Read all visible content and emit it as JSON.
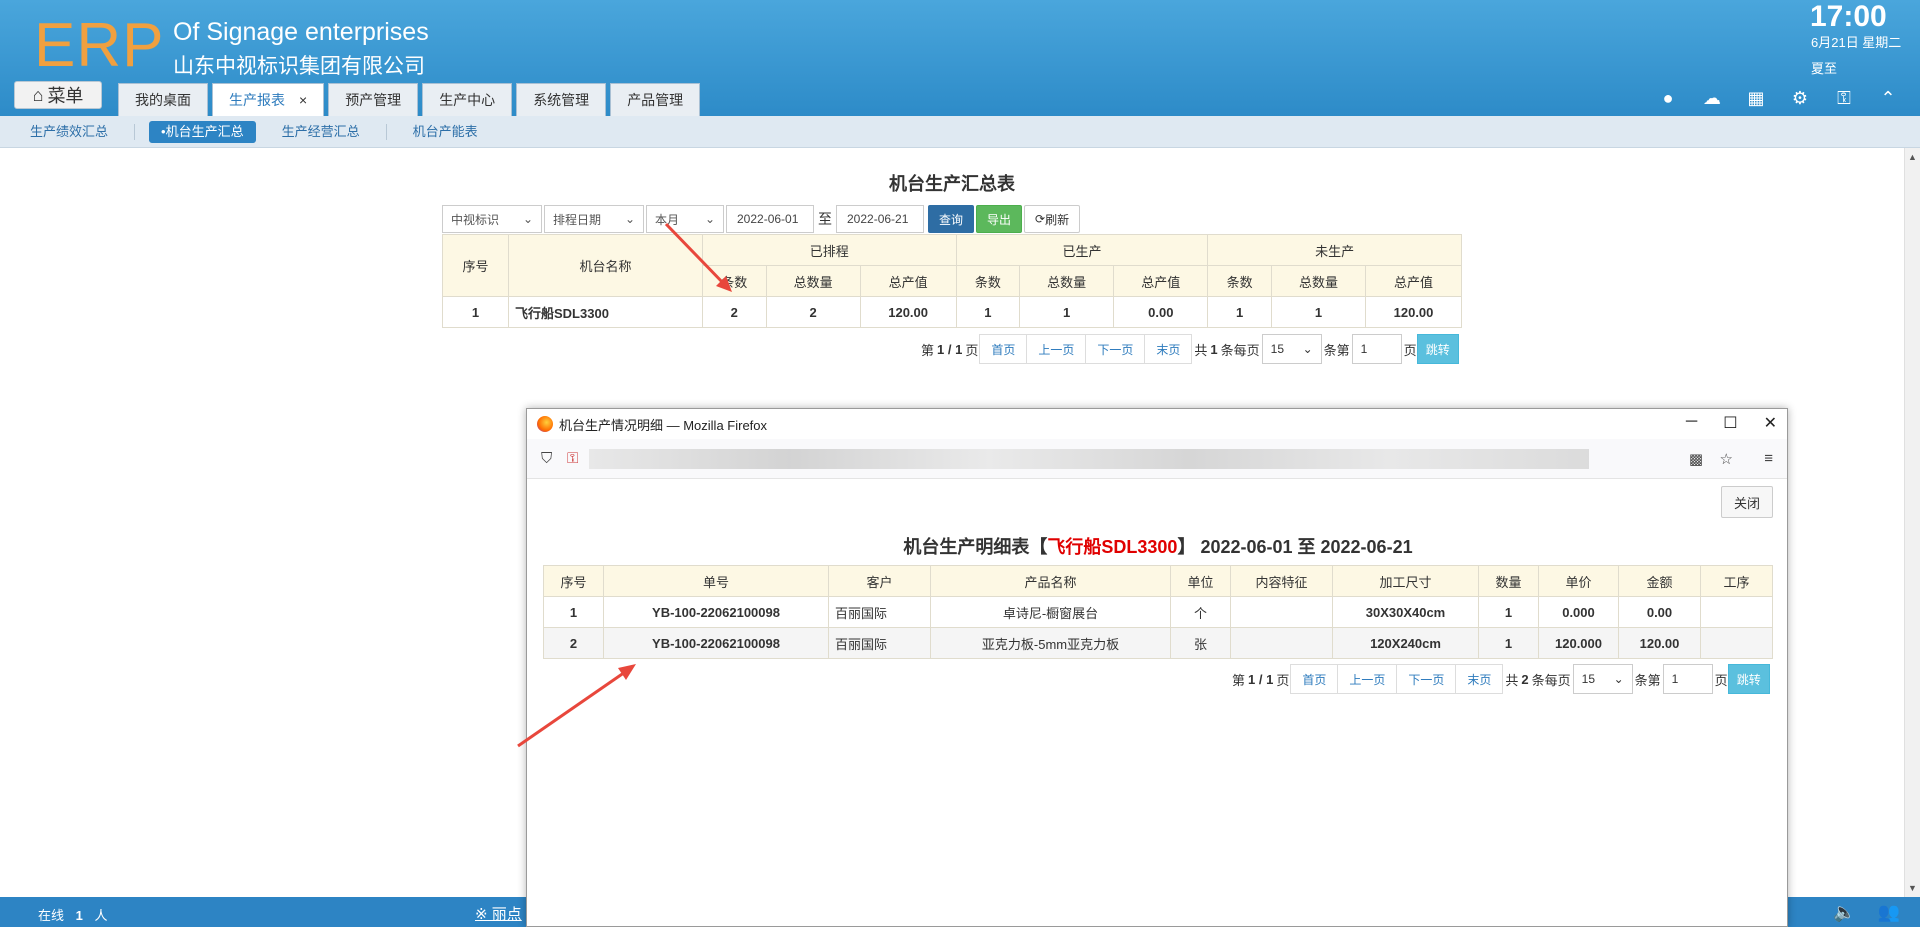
{
  "header": {
    "logo": "ERP",
    "company_en": "Of Signage enterprises",
    "company_cn": "山东中视标识集团有限公司",
    "time": "17:00",
    "date": "6月21日 星期二",
    "solar_term": "夏至",
    "menu_label": "菜单",
    "tabs": [
      {
        "label": "我的桌面"
      },
      {
        "label": "生产报表"
      },
      {
        "label": "预产管理"
      },
      {
        "label": "生产中心"
      },
      {
        "label": "系统管理"
      },
      {
        "label": "产品管理"
      }
    ],
    "tab_close": "×"
  },
  "subnav": {
    "items": [
      {
        "label": "生产绩效汇总"
      },
      {
        "label": "•机台生产汇总"
      },
      {
        "label": "生产经营汇总"
      },
      {
        "label": "机台产能表"
      }
    ]
  },
  "main": {
    "title": "机台生产汇总表",
    "filters": {
      "company": "中视标识",
      "date_type": "排程日期",
      "period": "本月",
      "date_from": "2022-06-01",
      "to_label": "至",
      "date_to": "2022-06-21",
      "query_btn": "查询",
      "export_btn": "导出",
      "refresh_btn": "刷新"
    },
    "table": {
      "h_seq": "序号",
      "h_machine": "机台名称",
      "h_scheduled": "已排程",
      "h_produced": "已生产",
      "h_unproduced": "未生产",
      "h_count": "条数",
      "h_qty": "总数量",
      "h_value": "总产值",
      "rows": [
        {
          "seq": "1",
          "machine": "飞行船SDL3300",
          "s_count": "2",
          "s_qty": "2",
          "s_value": "120.00",
          "p_count": "1",
          "p_qty": "1",
          "p_value": "0.00",
          "u_count": "1",
          "u_qty": "1",
          "u_value": "120.00"
        }
      ]
    },
    "pager": {
      "page_info_pre": "第",
      "page_info": "1 / 1",
      "page_info_post": "页",
      "first": "首页",
      "prev": "上一页",
      "next": "下一页",
      "last": "末页",
      "total_pre": "共",
      "total": "1",
      "total_post": "条每页",
      "per_page": "15",
      "jump_pre": "条第",
      "jump_page": "1",
      "jump_post": "页",
      "go": "跳转"
    }
  },
  "statusbar": {
    "online_pre": "在线",
    "online_count": "1",
    "online_post": "人",
    "marquee": "※ 丽点"
  },
  "popup": {
    "window_title": "机台生产情况明细 — Mozilla Firefox",
    "close_btn": "关闭",
    "title_pre": "机台生产明细表【",
    "title_machine": "飞行船SDL3300",
    "title_post": "】 2022-06-01 至 2022-06-21",
    "table": {
      "headers": [
        "序号",
        "单号",
        "客户",
        "产品名称",
        "单位",
        "内容特征",
        "加工尺寸",
        "数量",
        "单价",
        "金额",
        "工序"
      ],
      "rows": [
        [
          "1",
          "YB-100-22062100098",
          "百丽国际",
          "卓诗尼-橱窗展台",
          "个",
          "",
          "30X30X40cm",
          "1",
          "0.000",
          "0.00",
          ""
        ],
        [
          "2",
          "YB-100-22062100098",
          "百丽国际",
          "亚克力板-5mm亚克力板",
          "张",
          "",
          "120X240cm",
          "1",
          "120.000",
          "120.00",
          ""
        ]
      ]
    },
    "pager": {
      "page_info_pre": "第",
      "page_info": "1 / 1",
      "page_info_post": "页",
      "first": "首页",
      "prev": "上一页",
      "next": "下一页",
      "last": "末页",
      "total_pre": "共",
      "total": "2",
      "total_post": "条每页",
      "per_page": "15",
      "jump_pre": "条第",
      "jump_page": "1",
      "jump_post": "页",
      "go": "跳转"
    }
  },
  "colors": {
    "header_blue": "#2d8bc8",
    "logo_orange": "#f0a040",
    "accent_red": "#e00000",
    "link_blue": "#2d7bbd",
    "annotation_arrow": "#e8473c"
  },
  "icons": [
    "home-icon",
    "user-icon",
    "cloud-icon",
    "apps-icon",
    "gear-icon",
    "key-icon",
    "collapse-icon",
    "speaker-icon",
    "users-icon",
    "refresh-icon",
    "shield-icon",
    "star-icon",
    "qr-icon",
    "hamburger-icon"
  ]
}
